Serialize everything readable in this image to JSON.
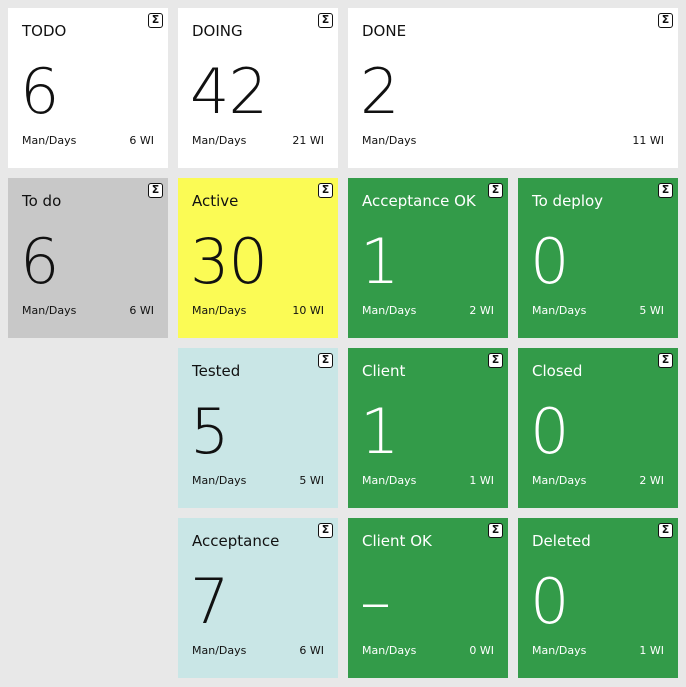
{
  "sigma_glyph": "Σ",
  "tiles": {
    "todo": {
      "title": "TODO",
      "value": "6",
      "unit": "Man/Days",
      "wi": "6 WI"
    },
    "doing": {
      "title": "DOING",
      "value": "42",
      "unit": "Man/Days",
      "wi": "21 WI"
    },
    "done": {
      "title": "DONE",
      "value": "2",
      "unit": "Man/Days",
      "wi": "11 WI"
    },
    "to_do": {
      "title": "To do",
      "value": "6",
      "unit": "Man/Days",
      "wi": "6 WI"
    },
    "active": {
      "title": "Active",
      "value": "30",
      "unit": "Man/Days",
      "wi": "10 WI"
    },
    "acceptance_ok": {
      "title": "Acceptance OK",
      "value": "1",
      "unit": "Man/Days",
      "wi": "2 WI"
    },
    "to_deploy": {
      "title": "To deploy",
      "value": "0",
      "unit": "Man/Days",
      "wi": "5 WI"
    },
    "tested": {
      "title": "Tested",
      "value": "5",
      "unit": "Man/Days",
      "wi": "5 WI"
    },
    "client": {
      "title": "Client",
      "value": "1",
      "unit": "Man/Days",
      "wi": "1 WI"
    },
    "closed": {
      "title": "Closed",
      "value": "0",
      "unit": "Man/Days",
      "wi": "2 WI"
    },
    "acceptance": {
      "title": "Acceptance",
      "value": "7",
      "unit": "Man/Days",
      "wi": "6 WI"
    },
    "client_ok": {
      "title": "Client OK",
      "value": "–",
      "unit": "Man/Days",
      "wi": "0 WI"
    },
    "deleted": {
      "title": "Deleted",
      "value": "0",
      "unit": "Man/Days",
      "wi": "1 WI"
    }
  },
  "colors": {
    "background": "#e8e8e8",
    "white": "#ffffff",
    "gray": "#c8c8c8",
    "yellow": "#fbfb55",
    "lightblue": "#c9e6e6",
    "green": "#339b49"
  }
}
